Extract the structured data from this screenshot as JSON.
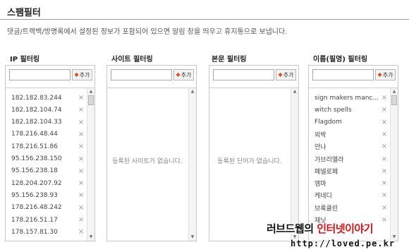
{
  "page": {
    "title": "스팸필터",
    "description": "댓글/트랙백/방명록에서 설정된 정보가 포함되어 있으면 알림 창을 띄우고 휴지통으로 보냅니다."
  },
  "panels": [
    {
      "heading": "IP 필터링",
      "input_value": "",
      "add_label": "추가",
      "empty_text": "",
      "items": [
        "182.182.83.244",
        "182.182.104.74",
        "182.182.104.33",
        "178.216.48.44",
        "178.216.51.86",
        "95.156.238.150",
        "95.156.238.18",
        "128.204.207.92",
        "95.156.238.93",
        "178.216.48.242",
        "178.216.51.17",
        "178.157.81.30"
      ]
    },
    {
      "heading": "사이트 필터링",
      "input_value": "",
      "add_label": "추가",
      "empty_text": "등록된 사이트가 없습니다.",
      "items": []
    },
    {
      "heading": "본문 필터링",
      "input_value": "",
      "add_label": "추가",
      "empty_text": "등록된 단어가 없습니다.",
      "items": []
    },
    {
      "heading": "이름(필명) 필터링",
      "input_value": "",
      "add_label": "추가",
      "empty_text": "",
      "items": [
        "sign makers manc...",
        "witch spells",
        "Flagdom",
        "외박",
        "안나",
        "가브리엘라",
        "페넬로페",
        "엠마",
        "케네디",
        "브룩클린",
        "재닛"
      ]
    }
  ],
  "watermark": {
    "part1": "러브드웹의 ",
    "part2": "인터넷이야기",
    "url": "http://loved.pe.kr"
  },
  "colors": {
    "add_icon": "#d9531e",
    "watermark_accent": "#d0161c"
  }
}
